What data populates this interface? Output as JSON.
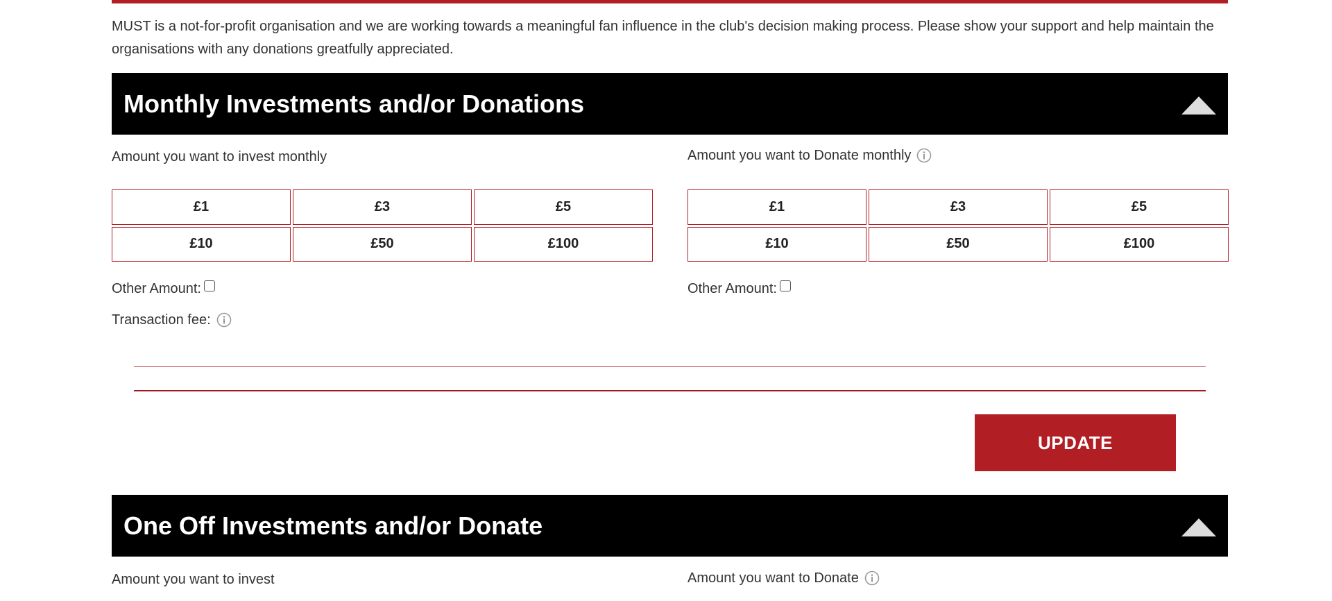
{
  "intro": {
    "text": "MUST is a not-for-profit organisation and we are working towards a meaningful fan influence in the club's decision making process. Please show your support and help maintain the organisations with any donations greatfully appreciated."
  },
  "monthly": {
    "title": "Monthly Investments and/or Donations",
    "toggle_icon": "chevron-up-triangle",
    "invest_label": "Amount you want to invest monthly",
    "donate_label": "Amount you want to Donate monthly",
    "invest_amounts": [
      "£1",
      "£3",
      "£5",
      "£10",
      "£50",
      "£100"
    ],
    "donate_amounts": [
      "£1",
      "£3",
      "£5",
      "£10",
      "£50",
      "£100"
    ],
    "invest_other_label": "Other Amount:",
    "donate_other_label": "Other Amount:",
    "transaction_fee_label": "Transaction fee:",
    "update_label": "UPDATE"
  },
  "oneoff": {
    "title": "One Off Investments and/or Donate",
    "toggle_icon": "chevron-up-triangle",
    "invest_label": "Amount you want to invest",
    "donate_label": "Amount you want to Donate"
  },
  "colors": {
    "accent": "#b11f24",
    "header_bg": "#000000",
    "header_text": "#ffffff",
    "text": "#333333",
    "info_icon": "#9a9a9a"
  }
}
